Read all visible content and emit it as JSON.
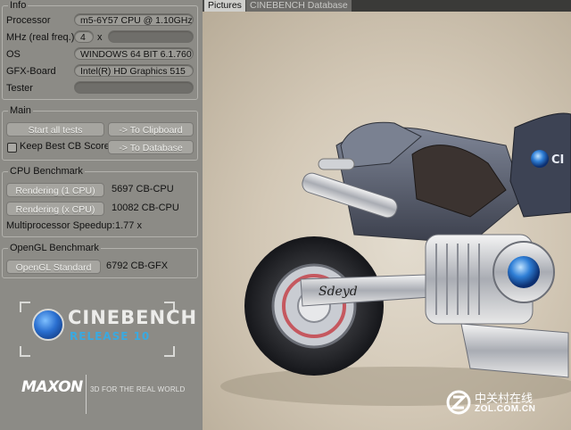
{
  "info": {
    "title": "Info",
    "rows": [
      {
        "label": "Processor",
        "value": "m5-6Y57 CPU @ 1.10GHz"
      },
      {
        "label": "MHz (real freq.)",
        "value": "4",
        "suffix": "x",
        "extra": ""
      },
      {
        "label": "OS",
        "value": "WINDOWS 64 BIT 6.1.760"
      },
      {
        "label": "GFX-Board",
        "value": "Intel(R) HD Graphics 515"
      },
      {
        "label": "Tester",
        "value": ""
      }
    ]
  },
  "main": {
    "title": "Main",
    "start_all_tests": "Start all tests",
    "to_clipboard": "-> To Clipboard",
    "keep_best": "Keep Best CB Score",
    "keep_best_checked": false,
    "to_database": "-> To Database"
  },
  "cpu": {
    "title": "CPU Benchmark",
    "rendering_1": "Rendering (1 CPU)",
    "rendering_1_score": "5697 CB-CPU",
    "rendering_x": "Rendering (x CPU)",
    "rendering_x_score": "10082 CB-CPU",
    "speedup_label": "Multiprocessor Speedup:",
    "speedup_value": "1.77 x"
  },
  "opengl": {
    "title": "OpenGL Benchmark",
    "standard": "OpenGL Standard",
    "score": "6792 CB-GFX"
  },
  "branding": {
    "product": "CINEBENCH",
    "release": "RELEASE 10",
    "company": "MAXON",
    "tagline": "3D FOR THE REAL WORLD"
  },
  "tabs": [
    {
      "label": "Pictures",
      "active": true
    },
    {
      "label": "CINEBENCH Database",
      "active": false
    }
  ],
  "watermark": {
    "cn": "中关村在线",
    "en": "ZOL.COM.CN"
  },
  "colors": {
    "panel": "#8c8b86",
    "accent_blue": "#3aa9e0",
    "scene_bg": "#d6cdbe"
  }
}
